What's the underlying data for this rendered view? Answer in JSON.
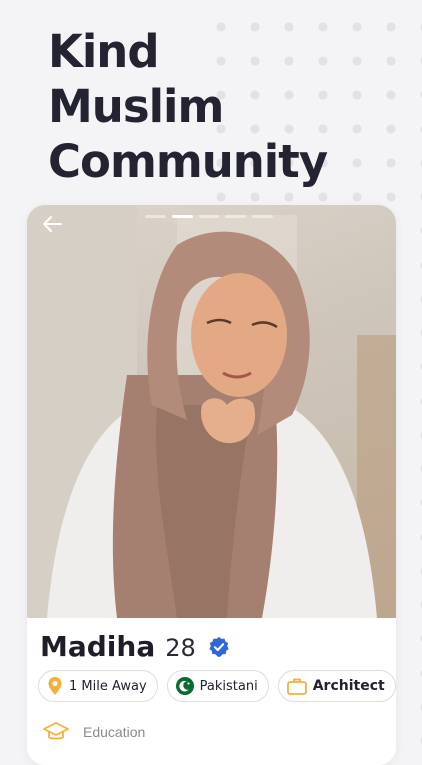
{
  "headline": {
    "lines": [
      "Kind",
      "Muslim",
      "Community"
    ]
  },
  "profile": {
    "name": "Madiha",
    "age": "28",
    "chips": {
      "distance": "1 Mile Away",
      "nationality": "Pakistani",
      "profession": "Architect"
    },
    "education_label": "Education"
  },
  "photo": {
    "progress_segments": 5,
    "active_segment": 1
  },
  "colors": {
    "headline": "#232332",
    "verified": "#2f67d6",
    "pin": "#f2b03a",
    "flag": "#0b6b2d",
    "briefcase": "#f2b03a"
  },
  "icons": [
    "back-arrow-icon",
    "verified-badge-icon",
    "location-pin-icon",
    "pakistan-flag-icon",
    "briefcase-icon",
    "graduation-cap-icon"
  ]
}
